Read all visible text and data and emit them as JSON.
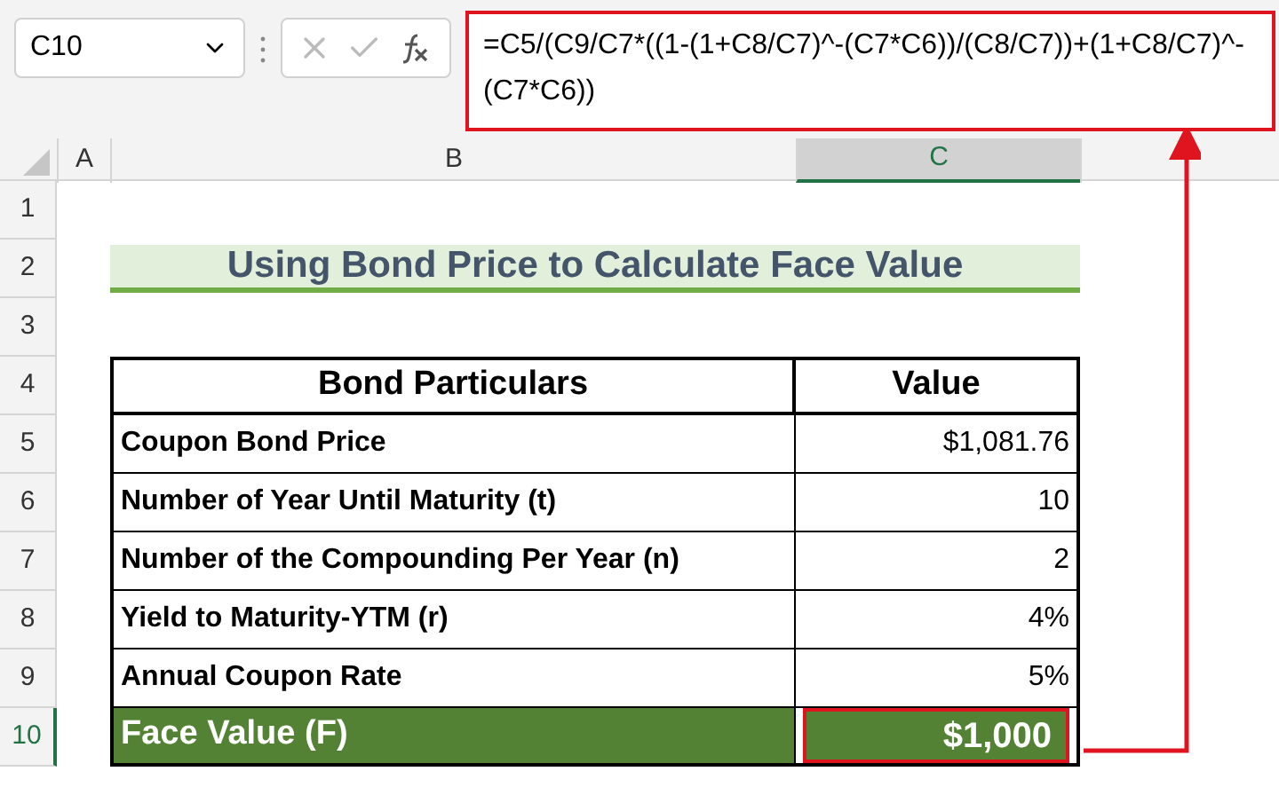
{
  "formula_bar": {
    "name_box": "C10",
    "formula": "=C5/(C9/C7*((1-(1+C8/C7)^-(C7*C6))/(C8/C7))+(1+C8/C7)^-(C7*C6))"
  },
  "columns": [
    {
      "label": "A",
      "selected": false
    },
    {
      "label": "B",
      "selected": false
    },
    {
      "label": "C",
      "selected": true
    }
  ],
  "row_numbers": [
    {
      "label": "1",
      "selected": false
    },
    {
      "label": "2",
      "selected": false
    },
    {
      "label": "3",
      "selected": false
    },
    {
      "label": "4",
      "selected": false
    },
    {
      "label": "5",
      "selected": false
    },
    {
      "label": "6",
      "selected": false
    },
    {
      "label": "7",
      "selected": false
    },
    {
      "label": "8",
      "selected": false
    },
    {
      "label": "9",
      "selected": false
    },
    {
      "label": "10",
      "selected": true
    }
  ],
  "title": "Using Bond Price to Calculate Face Value",
  "table": {
    "columns": [
      "Bond Particulars",
      "Value"
    ],
    "rows": [
      {
        "label": "Coupon Bond Price",
        "value": "$1,081.76",
        "kind": "data"
      },
      {
        "label": "Number of Year Until Maturity (t)",
        "value": "10",
        "kind": "data"
      },
      {
        "label": "Number of the Compounding Per Year (n)",
        "value": "2",
        "kind": "data"
      },
      {
        "label": "Yield to Maturity-YTM (r)",
        "value": "4%",
        "kind": "data"
      },
      {
        "label": "Annual Coupon Rate",
        "value": "5%",
        "kind": "data"
      },
      {
        "label": "Face Value (F)",
        "value": "$1,000",
        "kind": "result"
      }
    ]
  }
}
